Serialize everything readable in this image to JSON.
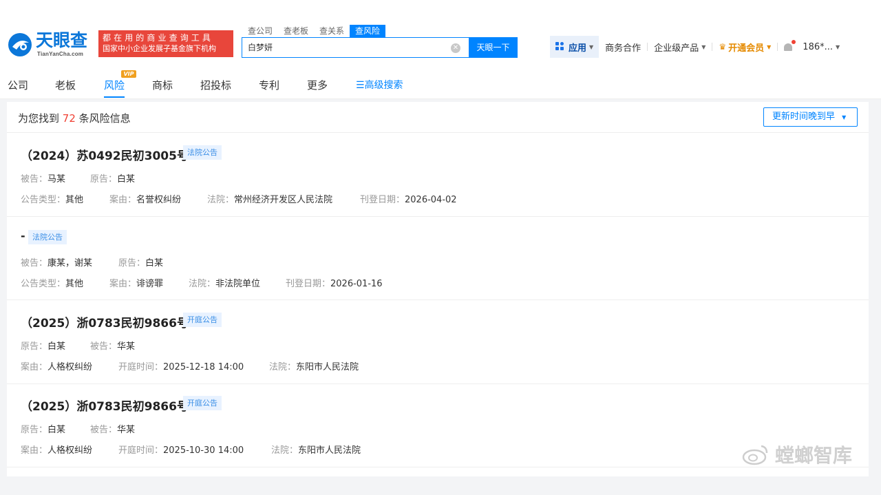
{
  "header": {
    "logo_cn": "天眼查",
    "logo_en": "TianYanCha.com",
    "slogan_line1": "都在用的商业查询工具",
    "slogan_line2": "国家中小企业发展子基金旗下机构",
    "search_tabs": [
      "查公司",
      "查老板",
      "查关系",
      "查风险"
    ],
    "search_value": "白梦妍",
    "search_button": "天眼一下",
    "nav": {
      "apps": "应用",
      "business": "商务合作",
      "enterprise": "企业级产品",
      "vip": "开通会员",
      "user": "186*..."
    }
  },
  "subnav": {
    "items": [
      "公司",
      "老板",
      "风险",
      "商标",
      "招投标",
      "专利",
      "更多"
    ],
    "active": "风险",
    "vip_badge": "VIP",
    "advanced_search": "高级搜索"
  },
  "results": {
    "count_prefix": "为您找到",
    "count": "72",
    "count_suffix": "条风险信息",
    "sort": "更新时间晚到早"
  },
  "items": [
    {
      "title": "（2024）苏0492民初3005号",
      "tag": "法院公告",
      "line1": [
        {
          "label": "被告：",
          "value": "马某"
        },
        {
          "label": "原告：",
          "value": "白某"
        }
      ],
      "line2": [
        {
          "label": "公告类型：",
          "value": "其他"
        },
        {
          "label": "案由：",
          "value": "名誉权纠纷"
        },
        {
          "label": "法院：",
          "value": "常州经济开发区人民法院"
        },
        {
          "label": "刊登日期：",
          "value": "2026-04-02"
        }
      ]
    },
    {
      "title": "-",
      "tag": "法院公告",
      "line1": [
        {
          "label": "被告：",
          "value": "康某，谢某"
        },
        {
          "label": "原告：",
          "value": "白某"
        }
      ],
      "line2": [
        {
          "label": "公告类型：",
          "value": "其他"
        },
        {
          "label": "案由：",
          "value": "诽谤罪"
        },
        {
          "label": "法院：",
          "value": "非法院单位"
        },
        {
          "label": "刊登日期：",
          "value": "2026-01-16"
        }
      ]
    },
    {
      "title": "（2025）浙0783民初9866号",
      "tag": "开庭公告",
      "line1": [
        {
          "label": "原告：",
          "value": "白某"
        },
        {
          "label": "被告：",
          "value": "华某"
        }
      ],
      "line2": [
        {
          "label": "案由：",
          "value": "人格权纠纷"
        },
        {
          "label": "开庭时间：",
          "value": "2025-12-18 14:00"
        },
        {
          "label": "法院：",
          "value": "东阳市人民法院"
        }
      ]
    },
    {
      "title": "（2025）浙0783民初9866号",
      "tag": "开庭公告",
      "line1": [
        {
          "label": "原告：",
          "value": "白某"
        },
        {
          "label": "被告：",
          "value": "华某"
        }
      ],
      "line2": [
        {
          "label": "案由：",
          "value": "人格权纠纷"
        },
        {
          "label": "开庭时间：",
          "value": "2025-10-30 14:00"
        },
        {
          "label": "法院：",
          "value": "东阳市人民法院"
        }
      ]
    }
  ],
  "watermark": "螳螂智库",
  "colors": {
    "brand": "#0084ff",
    "highlight": "#f04134",
    "slogan_bg": "#e8463b",
    "vip": "#e58a00"
  }
}
